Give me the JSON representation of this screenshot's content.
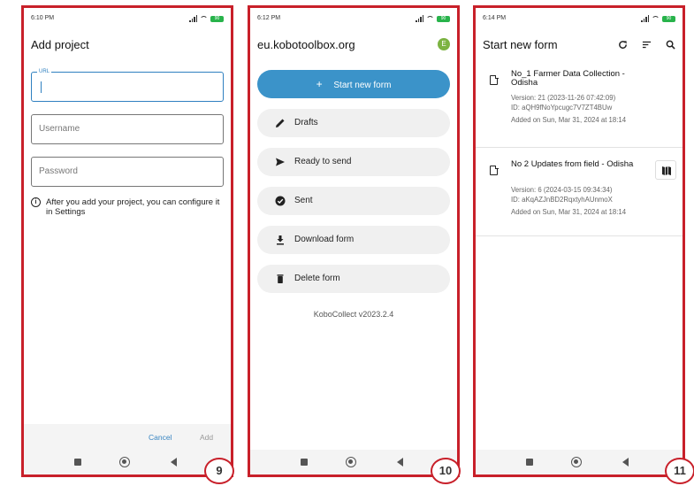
{
  "screen9": {
    "status_time": "6:10 PM",
    "battery": "90",
    "title": "Add project",
    "url_label": "URL",
    "url_value": "",
    "username_placeholder": "Username",
    "password_placeholder": "Password",
    "info_text": "After you add your project, you can configure it in Settings",
    "cancel_label": "Cancel",
    "add_label": "Add",
    "step_number": "9"
  },
  "screen10": {
    "status_time": "6:12 PM",
    "battery": "90",
    "server": "eu.kobotoolbox.org",
    "avatar_letter": "E",
    "start_label": "Start new form",
    "menu": [
      {
        "label": "Drafts",
        "icon": "pencil-icon"
      },
      {
        "label": "Ready to send",
        "icon": "send-icon"
      },
      {
        "label": "Sent",
        "icon": "check-circle-icon"
      },
      {
        "label": "Download form",
        "icon": "download-icon"
      },
      {
        "label": "Delete form",
        "icon": "trash-icon"
      }
    ],
    "version": "KoboCollect v2023.2.4",
    "step_number": "10"
  },
  "screen11": {
    "status_time": "6:14 PM",
    "battery": "90",
    "title": "Start new form",
    "forms": [
      {
        "title": "No_1 Farmer Data Collection - Odisha",
        "version": "Version: 21 (2023-11-26 07:42:09)",
        "id": "ID: aQH9fNoYpcugc7V7ZT4BUw",
        "added": "Added on Sun, Mar 31, 2024 at 18:14"
      },
      {
        "title": "No 2 Updates from field - Odisha",
        "version": "Version: 6 (2024-03-15 09:34:34)",
        "id": "ID: aKqAZJnBD2RqxtyhAUnmoX",
        "added": "Added on Sun, Mar 31, 2024 at 18:14"
      }
    ],
    "step_number": "11"
  },
  "colors": {
    "frame": "#c8202a",
    "primary": "#3b93c9",
    "avatar": "#7cb342",
    "battery": "#28b34b"
  }
}
